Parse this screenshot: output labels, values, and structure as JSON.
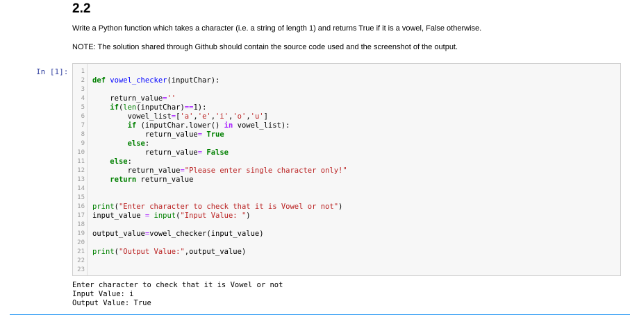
{
  "markdown": {
    "heading": "2.2",
    "question": "Write a Python function which takes a character (i.e. a string of length 1) and returns True if it is a vowel, False otherwise.",
    "note": "NOTE: The solution shared through Github should contain the source code used and the screenshot of the output."
  },
  "cell": {
    "prompt": "In [1]:",
    "line_numbers": [
      "1",
      "2",
      "3",
      "4",
      "5",
      "6",
      "7",
      "8",
      "9",
      "10",
      "11",
      "12",
      "13",
      "14",
      "15",
      "16",
      "17",
      "18",
      "19",
      "20",
      "21",
      "22",
      "23"
    ],
    "code": {
      "l2_def": "def",
      "l2_name": "vowel_checker",
      "l2_rest": "(inputChar):",
      "l4_a": "return_value",
      "l4_op": "=",
      "l4_str": "''",
      "l5_if": "if",
      "l5_a": "(",
      "l5_len": "len",
      "l5_b": "(inputChar)",
      "l5_op": "==",
      "l5_c": "1):",
      "l6_a": "vowel_list",
      "l6_op": "=",
      "l6_b": "[",
      "l6_s1": "'a'",
      "l6_c1": ",",
      "l6_s2": "'e'",
      "l6_c2": ",",
      "l6_s3": "'i'",
      "l6_c3": ",",
      "l6_s4": "'o'",
      "l6_c4": ",",
      "l6_s5": "'u'",
      "l6_e": "]",
      "l7_if": "if",
      "l7_a": " (inputChar.lower() ",
      "l7_in": "in",
      "l7_b": " vowel_list):",
      "l8_a": "return_value",
      "l8_op": "=",
      "l8_true": "True",
      "l9_else": "else",
      "l9_c": ":",
      "l10_a": "return_value",
      "l10_op": "=",
      "l10_false": "False",
      "l11_else": "else",
      "l11_c": ":",
      "l12_a": "return_value",
      "l12_op": "=",
      "l12_str": "\"Please enter single character only!\"",
      "l13_ret": "return",
      "l13_rest": " return_value",
      "l16_print": "print",
      "l16_a": "(",
      "l16_str": "\"Enter character to check that it is Vowel or not\"",
      "l16_b": ")",
      "l17_a": "input_value ",
      "l17_op": "=",
      "l17_sp": " ",
      "l17_input": "input",
      "l17_b": "(",
      "l17_str": "\"Input Value: \"",
      "l17_c": ")",
      "l19_a": "output_value",
      "l19_op": "=",
      "l19_b": "vowel_checker(input_value)",
      "l21_print": "print",
      "l21_a": "(",
      "l21_str": "\"Output Value:\"",
      "l21_b": ",output_value)"
    },
    "output": [
      "Enter character to check that it is Vowel or not",
      "Input Value: i",
      "Output Value: True"
    ]
  }
}
